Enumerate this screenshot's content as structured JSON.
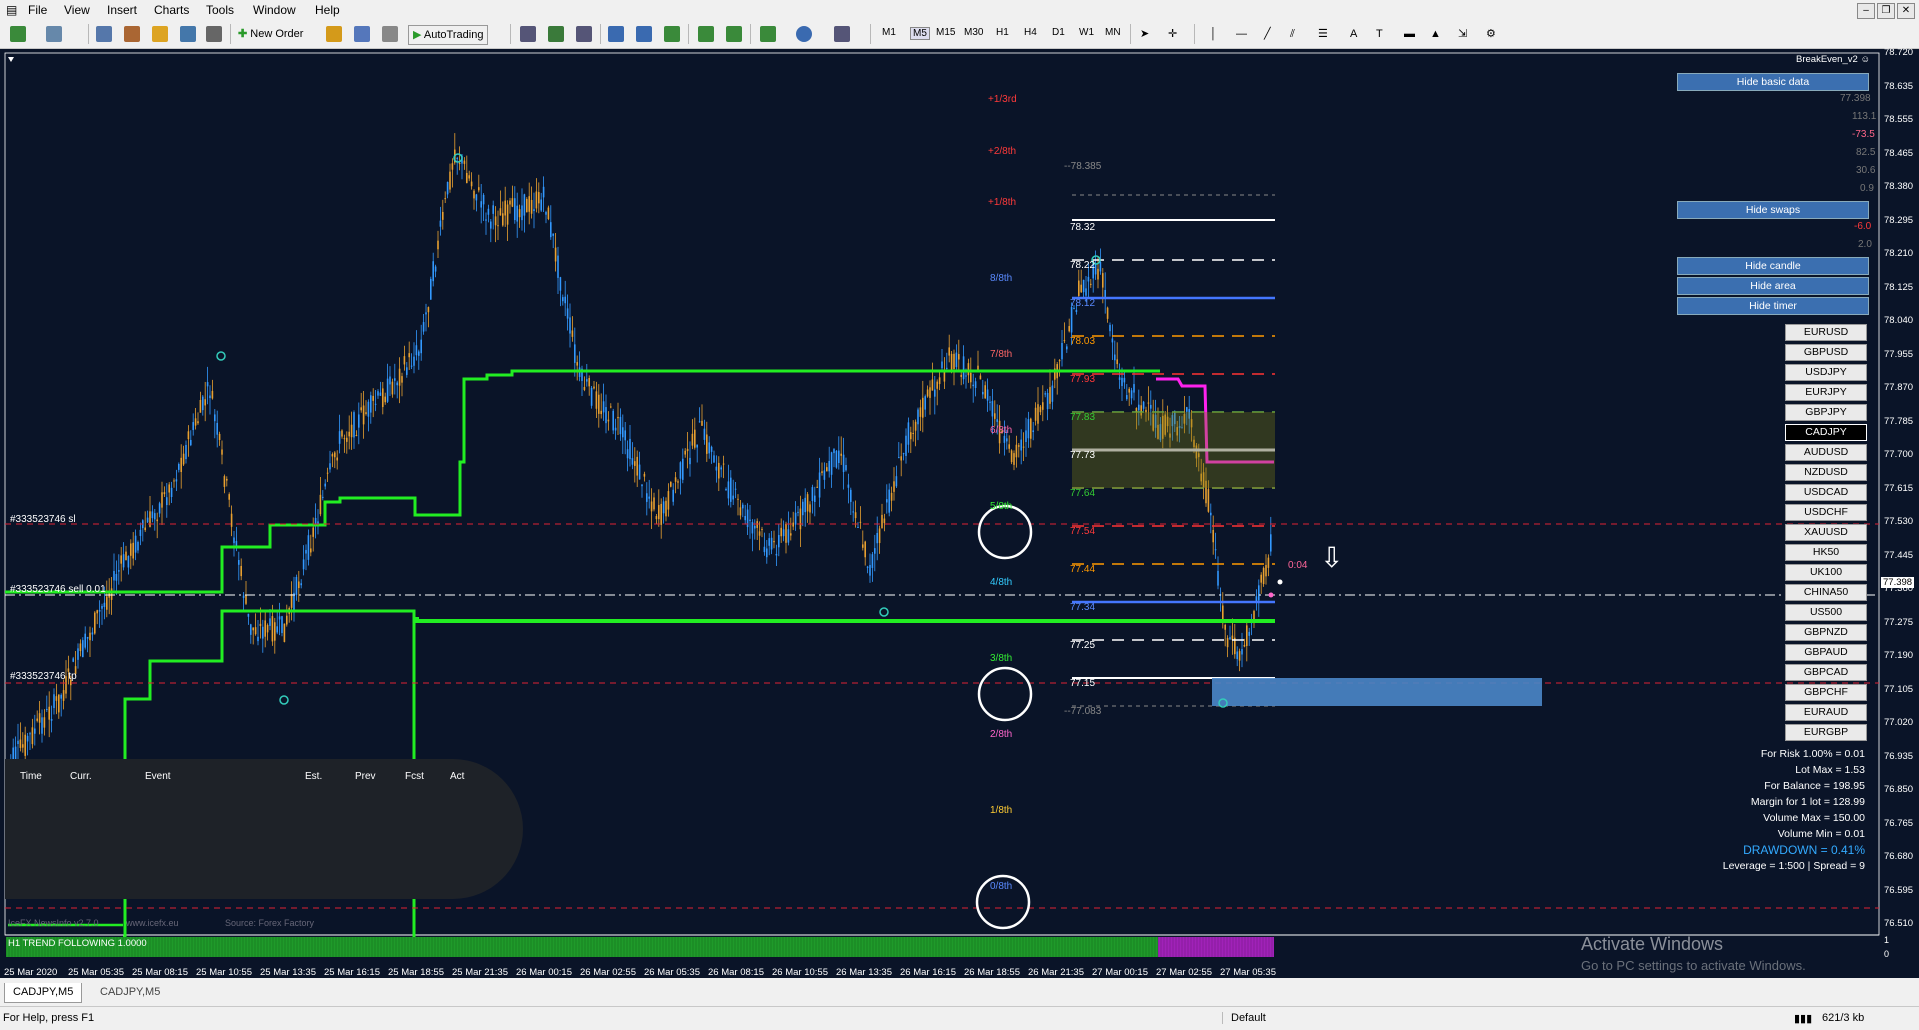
{
  "menu": [
    "File",
    "View",
    "Insert",
    "Charts",
    "Tools",
    "Window",
    "Help"
  ],
  "toolbar": {
    "new_order": "New Order",
    "autotrading": "AutoTrading"
  },
  "timeframes": [
    "M1",
    "M5",
    "M15",
    "M30",
    "H1",
    "H4",
    "D1",
    "W1",
    "MN"
  ],
  "indicator_name": "BreakEven_v2",
  "panel_buttons": {
    "hide_basic": "Hide basic data",
    "hide_swaps": "Hide swaps",
    "hide_candle": "Hide candle",
    "hide_area": "Hide area",
    "hide_timer": "Hide timer"
  },
  "basic_values": [
    "77.398",
    "113.1",
    "-73.5",
    "82.5",
    "30.6",
    "0.9"
  ],
  "swap_values": [
    "-6.0",
    "2.0"
  ],
  "symbols": [
    "EURUSD",
    "GBPUSD",
    "USDJPY",
    "EURJPY",
    "GBPJPY",
    "CADJPY",
    "AUDUSD",
    "NZDUSD",
    "USDCAD",
    "USDCHF",
    "XAUUSD",
    "HK50",
    "UK100",
    "CHINA50",
    "US500",
    "GBPNZD",
    "GBPAUD",
    "GBPCAD",
    "GBPCHF",
    "EURAUD",
    "EURGBP"
  ],
  "selected_symbol": "CADJPY",
  "risk_info": {
    "for_risk": "For Risk 1.00% = 0.01",
    "lot_max": "Lot Max = 1.53",
    "for_balance": "For Balance = 198.95",
    "margin": "Margin for 1 lot = 128.99",
    "volume_max": "Volume Max = 150.00",
    "volume_min": "Volume Min = 0.01",
    "drawdown": "DRAWDOWN =  0.41%",
    "leverage": "Leverage = 1:500 | Spread = 9"
  },
  "murrey_labels": [
    "+1/3rd",
    "+2/8th",
    "+1/8th",
    "8/8th",
    "7/8th",
    "6/8th",
    "5/8th",
    "4/8th",
    "3/8th",
    "2/8th",
    "1/8th",
    "0/8th"
  ],
  "order_labels": {
    "sl": "#333523746 sl",
    "sell": "#333523746 sell 0.01",
    "tp": "#333523746 tp"
  },
  "level_prices": [
    "78.385",
    "78.32",
    "78.22",
    "78.12",
    "78.03",
    "77.93",
    "77.83",
    "77.73",
    "77.64",
    "77.54",
    "77.44",
    "77.34",
    "77.25",
    "77.15",
    "77.083"
  ],
  "timer_text": "0:04",
  "news_panel": {
    "headers": [
      "Time",
      "Curr.",
      "Event",
      "Est.",
      "Prev",
      "Fcst",
      "Act"
    ],
    "footer_name": "IceFX NewsInfo v2.7.0",
    "footer_site": "www.icefx.eu",
    "footer_source": "Source: Forex Factory"
  },
  "trend_label": "H1 TREND FOLLOWING 1.0000",
  "price_axis": [
    "78.720",
    "78.635",
    "78.555",
    "78.465",
    "78.380",
    "78.295",
    "78.210",
    "78.125",
    "78.040",
    "77.955",
    "77.870",
    "77.785",
    "77.700",
    "77.615",
    "77.530",
    "77.445",
    "77.360",
    "77.275",
    "77.190",
    "77.105",
    "77.020",
    "76.935",
    "76.850",
    "76.765",
    "76.680",
    "76.595",
    "76.510"
  ],
  "current_price": "77.398",
  "sub_axis": [
    "1",
    "0"
  ],
  "time_axis": [
    "25 Mar 2020",
    "25 Mar 05:35",
    "25 Mar 08:15",
    "25 Mar 10:55",
    "25 Mar 13:35",
    "25 Mar 16:15",
    "25 Mar 18:55",
    "25 Mar 21:35",
    "26 Mar 00:15",
    "26 Mar 02:55",
    "26 Mar 05:35",
    "26 Mar 08:15",
    "26 Mar 10:55",
    "26 Mar 13:35",
    "26 Mar 16:15",
    "26 Mar 18:55",
    "26 Mar 21:35",
    "27 Mar 00:15",
    "27 Mar 02:55",
    "27 Mar 05:35"
  ],
  "watermark": {
    "line1": "Activate Windows",
    "line2": "Go to PC settings to activate Windows."
  },
  "tabs": [
    "CADJPY,M5",
    "CADJPY,M5"
  ],
  "status": {
    "help": "For Help, press F1",
    "profile": "Default",
    "traffic": "621/3 kb"
  }
}
